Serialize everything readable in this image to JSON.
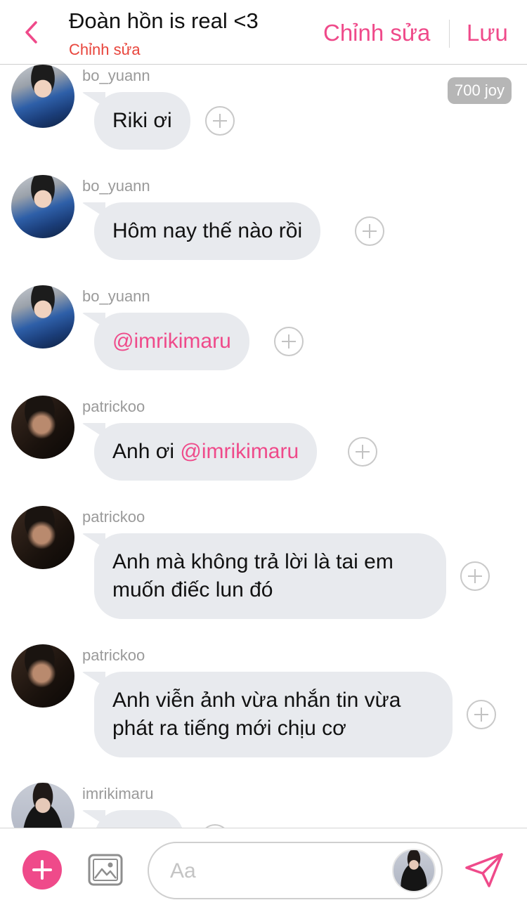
{
  "header": {
    "title": "Đoàn hồn is real <3",
    "subtitle": "Chỉnh sửa",
    "edit_label": "Chỉnh sửa",
    "save_label": "Lưu",
    "accent_color": "#ef4a8a",
    "subtitle_color": "#e8453c"
  },
  "badge": {
    "label": "700 joy"
  },
  "messages": [
    {
      "username": "bo_yuann",
      "text": "Riki ơi"
    },
    {
      "username": "bo_yuann",
      "text": "Hôm nay thế nào rồi"
    },
    {
      "username": "bo_yuann",
      "mention": "@imrikimaru"
    },
    {
      "username": "patrickoo",
      "text": "Anh ơi ",
      "mention": "@imrikimaru"
    },
    {
      "username": "patrickoo",
      "line1": "Anh mà không trả lời là tai em",
      "line2": "muốn điếc lun đó"
    },
    {
      "username": "patrickoo",
      "line1": "Anh viễn ảnh vừa nhắn tin vừa",
      "line2": "phát ra tiếng mới chịu cơ"
    },
    {
      "username": "imrikimaru",
      "text": ""
    }
  ],
  "composer": {
    "placeholder": "Aa",
    "add_icon": "plus-icon",
    "image_icon": "image-icon",
    "send_icon": "send-icon"
  }
}
